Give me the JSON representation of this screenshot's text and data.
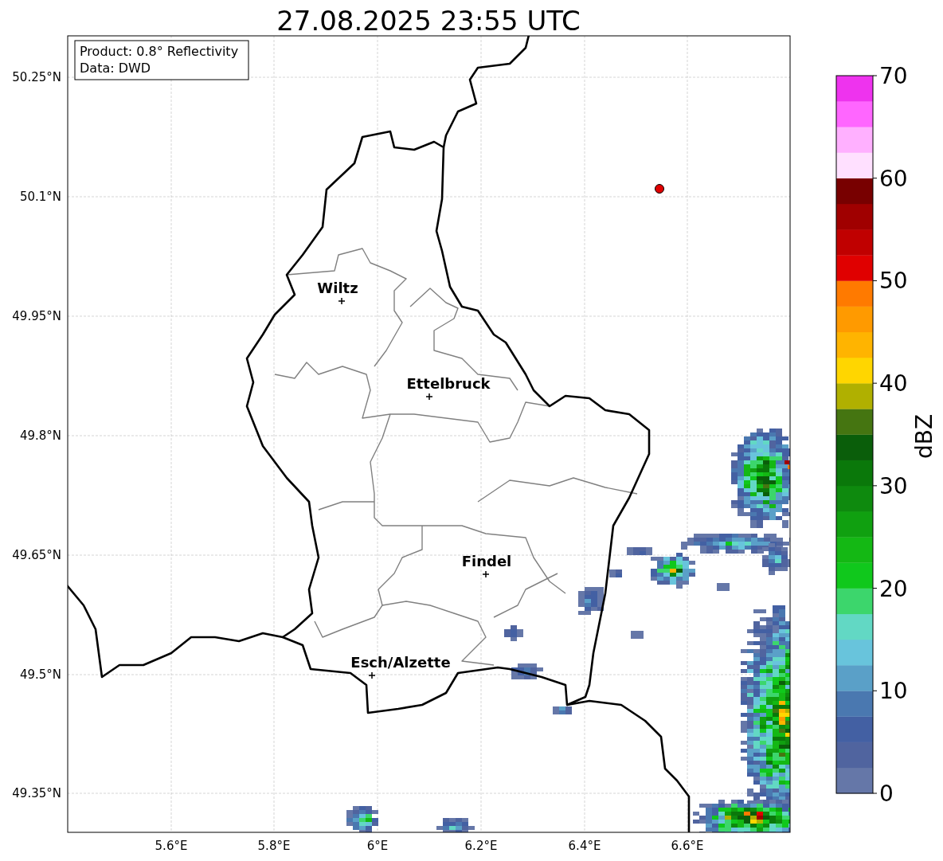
{
  "title": "27.08.2025 23:55 UTC",
  "info_box": [
    "Product: 0.8° Reflectivity",
    "Data: DWD"
  ],
  "cities": [
    {
      "name": "Wiltz"
    },
    {
      "name": "Ettelbruck"
    },
    {
      "name": "Findel"
    },
    {
      "name": "Esch/Alzette"
    }
  ],
  "y_ticks": [
    "50.25°N",
    "50.1°N",
    "49.95°N",
    "49.8°N",
    "49.65°N",
    "49.5°N",
    "49.35°N"
  ],
  "x_ticks": [
    "5.6°E",
    "5.8°E",
    "6°E",
    "6.2°E",
    "6.4°E",
    "6.6°E"
  ],
  "colorbar": {
    "label": "dBZ",
    "ticks": [
      "70",
      "60",
      "50",
      "40",
      "30",
      "20",
      "10",
      "0"
    ],
    "bins": [
      {
        "color": "#6577a8"
      },
      {
        "color": "#50649f"
      },
      {
        "color": "#4360a3"
      },
      {
        "color": "#4a78b0"
      },
      {
        "color": "#5aa0c8"
      },
      {
        "color": "#68c4dc"
      },
      {
        "color": "#62d8c4"
      },
      {
        "color": "#3cd66c"
      },
      {
        "color": "#10c81c"
      },
      {
        "color": "#14b814"
      },
      {
        "color": "#10a010"
      },
      {
        "color": "#0e8a0e"
      },
      {
        "color": "#0a780a"
      },
      {
        "color": "#0a5e0a"
      },
      {
        "color": "#457511"
      },
      {
        "color": "#b0b000"
      },
      {
        "color": "#ffd600"
      },
      {
        "color": "#ffb400"
      },
      {
        "color": "#ff9a00"
      },
      {
        "color": "#ff7a00"
      },
      {
        "color": "#e00000"
      },
      {
        "color": "#c00000"
      },
      {
        "color": "#a00000"
      },
      {
        "color": "#780000"
      },
      {
        "color": "#ffe0ff"
      },
      {
        "color": "#ffb0ff"
      },
      {
        "color": "#ff66ff"
      },
      {
        "color": "#ee33ee"
      }
    ]
  }
}
